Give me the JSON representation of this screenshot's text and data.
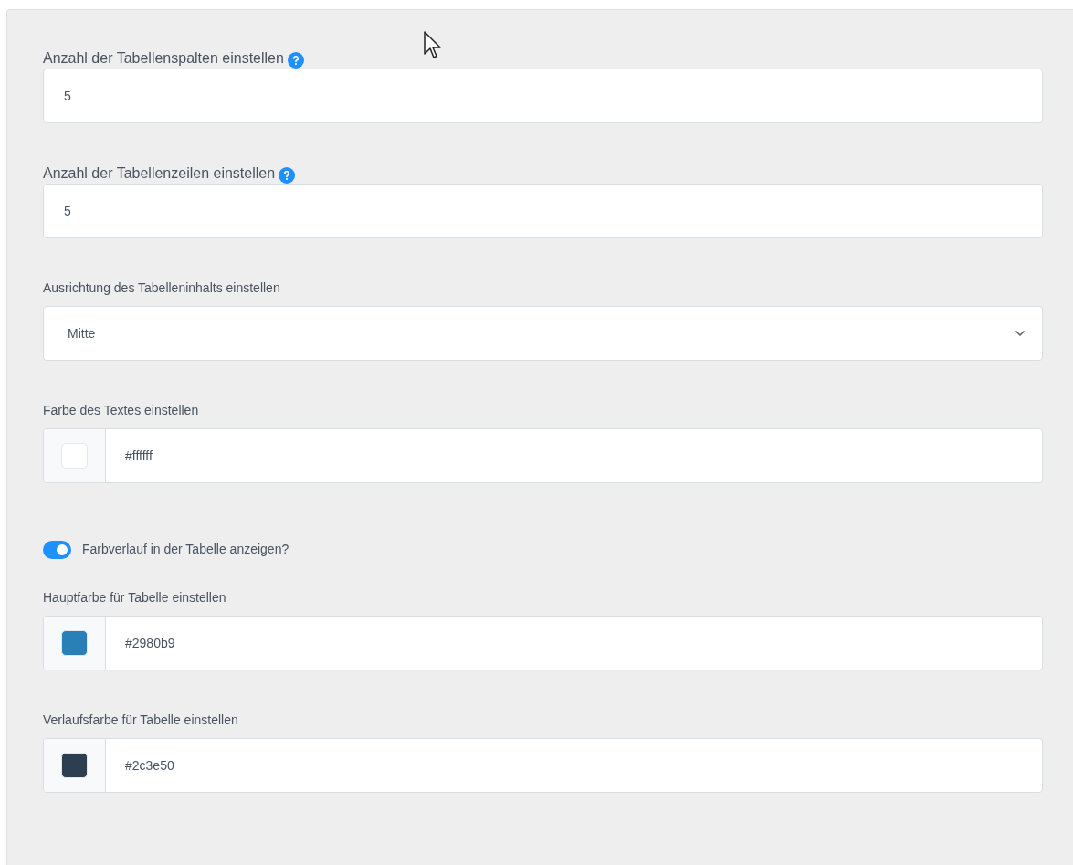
{
  "fields": [
    {
      "kind": "number",
      "label": "Anzahl der Tabellenspalten einstellen",
      "help": true,
      "value": "5"
    },
    {
      "kind": "number",
      "label": "Anzahl der Tabellenzeilen einstellen",
      "help": true,
      "value": "5"
    },
    {
      "kind": "select",
      "label": "Ausrichtung des Tabelleninhalts einstellen",
      "value": "Mitte"
    },
    {
      "kind": "color",
      "label": "Farbe des Textes einstellen",
      "value": "#ffffff",
      "color": "#ffffff"
    },
    {
      "kind": "toggle",
      "label": "Farbverlauf in der Tabelle anzeigen?",
      "on": true
    },
    {
      "kind": "color",
      "label": "Hauptfarbe für Tabelle einstellen",
      "value": "#2980b9",
      "color": "#2980b9"
    },
    {
      "kind": "color",
      "label": "Verlaufsfarbe für Tabelle einstellen",
      "value": "#2c3e50",
      "color": "#2c3e50"
    }
  ]
}
